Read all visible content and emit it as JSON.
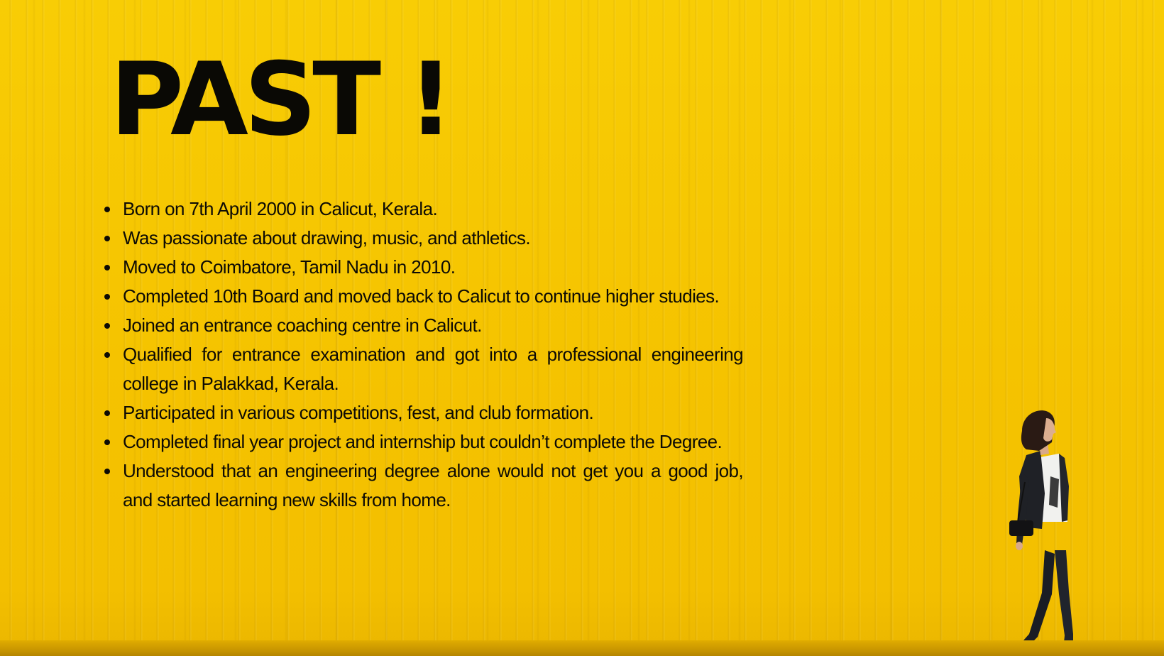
{
  "slide": {
    "title": "PAST !",
    "accent_color": "#f5c400",
    "text_color": "#0d0b05",
    "bullets": [
      "Born on 7th April 2000 in Calicut, Kerala.",
      "Was passionate about drawing, music, and athletics.",
      "Moved to Coimbatore, Tamil Nadu in 2010.",
      "Completed 10th Board and moved back to Calicut to continue higher studies.",
      " Joined an entrance coaching centre in Calicut.",
      " Qualified for entrance examination and got into a professional engineering college in Palakkad, Kerala.",
      " Participated in various competitions, fest, and club formation.",
      " Completed final year project and internship but couldn’t complete the Degree.",
      " Understood that an engineering degree alone would not get you a good job, and started learning new skills from home."
    ],
    "illustration": "walking-woman-figure"
  }
}
